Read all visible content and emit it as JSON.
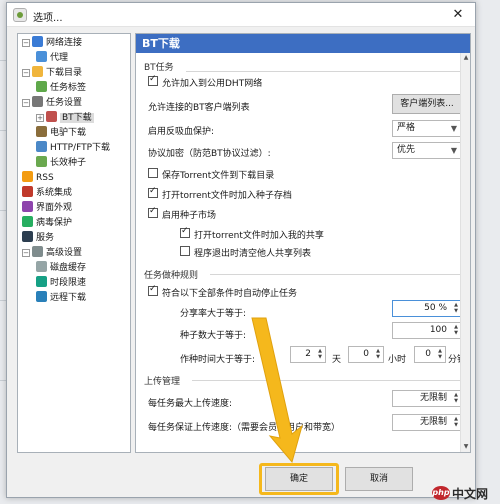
{
  "window": {
    "title": "选项..."
  },
  "tree": [
    {
      "label": "网络连接",
      "icon": "globe-icon",
      "level": 0,
      "expander": "−"
    },
    {
      "label": "代理",
      "icon": "proxy-icon",
      "level": 1,
      "expander": ""
    },
    {
      "label": "下载目录",
      "icon": "folder-icon",
      "level": 0,
      "expander": "−"
    },
    {
      "label": "任务标签",
      "icon": "tag-icon",
      "level": 1,
      "expander": ""
    },
    {
      "label": "任务设置",
      "icon": "gear-icon",
      "level": 0,
      "expander": "−"
    },
    {
      "label": "BT下载",
      "icon": "bt-icon",
      "level": 1,
      "expander": "+",
      "selected": true
    },
    {
      "label": "电驴下载",
      "icon": "emule-icon",
      "level": 1,
      "expander": ""
    },
    {
      "label": "HTTP/FTP下载",
      "icon": "http-icon",
      "level": 1,
      "expander": ""
    },
    {
      "label": "长效种子",
      "icon": "seed-icon",
      "level": 1,
      "expander": ""
    },
    {
      "label": "RSS",
      "icon": "rss-icon",
      "level": 0,
      "expander": ""
    },
    {
      "label": "系统集成",
      "icon": "puzzle-icon",
      "level": 0,
      "expander": ""
    },
    {
      "label": "界面外观",
      "icon": "palette-icon",
      "level": 0,
      "expander": ""
    },
    {
      "label": "病毒保护",
      "icon": "shield-icon",
      "level": 0,
      "expander": ""
    },
    {
      "label": "服务",
      "icon": "service-icon",
      "level": 0,
      "expander": ""
    },
    {
      "label": "高级设置",
      "icon": "advanced-icon",
      "level": 0,
      "expander": "−"
    },
    {
      "label": "磁盘缓存",
      "icon": "disk-icon",
      "level": 1,
      "expander": ""
    },
    {
      "label": "时段限速",
      "icon": "clock-icon",
      "level": 1,
      "expander": ""
    },
    {
      "label": "远程下载",
      "icon": "remote-icon",
      "level": 1,
      "expander": ""
    }
  ],
  "panel": {
    "header": "BT下载",
    "bt_task": {
      "title": "BT任务",
      "dht": {
        "label": "允许加入到公用DHT网络",
        "checked": true
      },
      "client_list_label": "允许连接的BT客户端列表",
      "client_list_button": "客户端列表...",
      "anti_leech_label": "启用反吸血保护:",
      "anti_leech_value": "严格",
      "encrypt_label": "协议加密（防范BT协议过滤）:",
      "encrypt_value": "优先",
      "save_torrent": {
        "label": "保存Torrent文件到下载目录",
        "checked": false
      },
      "add_seed_on_open": {
        "label": "打开torrent文件时加入种子存档",
        "checked": true
      },
      "seed_market": {
        "label": "启用种子市场",
        "checked": true
      },
      "add_to_share": {
        "label": "打开torrent文件时加入我的共享",
        "checked": true
      },
      "clear_share_on_exit": {
        "label": "程序退出时清空他人共享列表",
        "checked": false
      }
    },
    "seeding": {
      "title": "任务做种规则",
      "auto_stop": {
        "label": "符合以下全部条件时自动停止任务",
        "checked": true
      },
      "ratio_label": "分享率大于等于:",
      "ratio_value": "50 %",
      "seeds_label": "种子数大于等于:",
      "seeds_value": "100",
      "time_label": "作种时间大于等于:",
      "days_value": "2",
      "days_unit": "天",
      "hours_value": "0",
      "hours_unit": "小时",
      "minutes_value": "0",
      "minutes_unit": "分钟"
    },
    "upload": {
      "title": "上传管理",
      "max_per_task_label": "每任务最大上传速度:",
      "max_per_task_value": "无限制",
      "guarantee_label": "每任务保证上传速度:（需要会员的用户和带宽）",
      "guarantee_value": "无限制"
    }
  },
  "footer": {
    "ok": "确定",
    "cancel": "取消"
  },
  "watermark": {
    "logo": "php",
    "text": "中文网"
  },
  "colors": {
    "header_bg": "#3d6ec2",
    "highlight": "#f5b81c"
  }
}
